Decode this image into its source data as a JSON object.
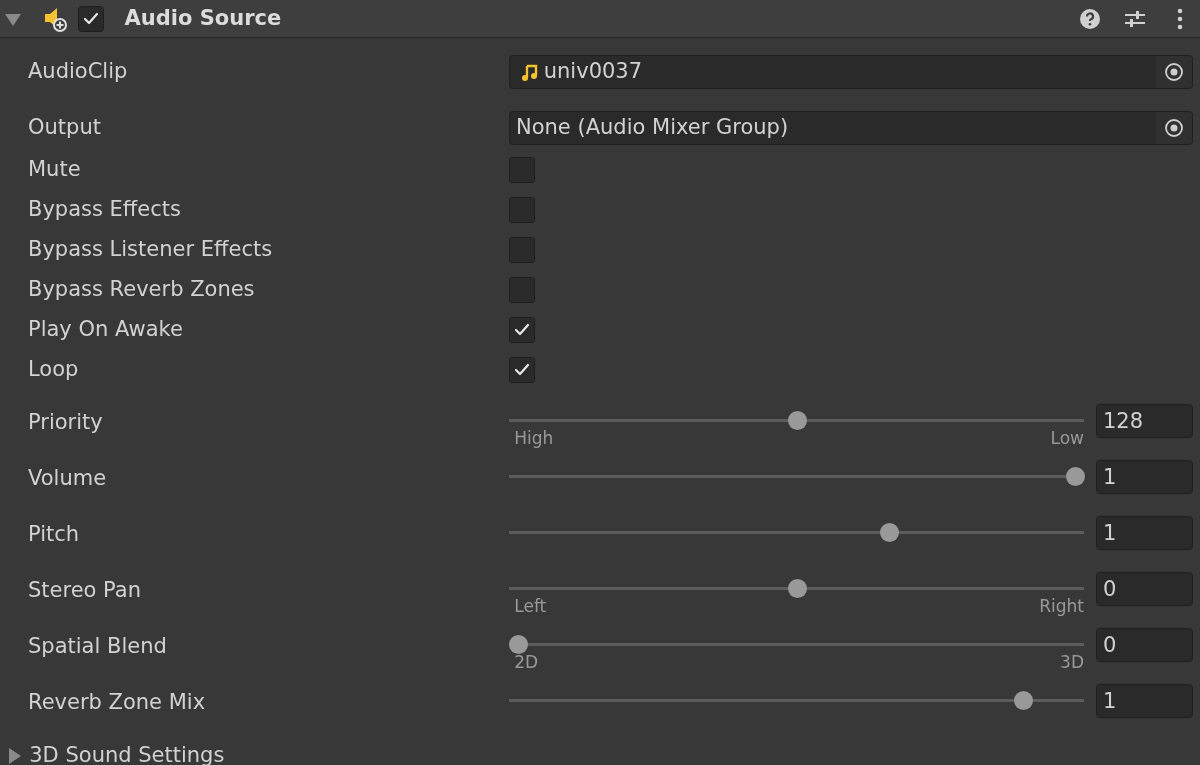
{
  "component": {
    "title": "Audio Source",
    "enabled": true,
    "expanded": true
  },
  "properties": [
    {
      "kind": "clip",
      "label": "AudioClip",
      "value": "univ0037"
    },
    {
      "kind": "object",
      "label": "Output",
      "value": "None (Audio Mixer Group)"
    },
    {
      "kind": "checkbox",
      "label": "Mute",
      "checked": false
    },
    {
      "kind": "checkbox",
      "label": "Bypass Effects",
      "checked": false
    },
    {
      "kind": "checkbox",
      "label": "Bypass Listener Effects",
      "checked": false
    },
    {
      "kind": "checkbox",
      "label": "Bypass Reverb Zones",
      "checked": false
    },
    {
      "kind": "checkbox",
      "label": "Play On Awake",
      "checked": true
    },
    {
      "kind": "checkbox",
      "label": "Loop",
      "checked": true
    },
    {
      "kind": "slider",
      "label": "Priority",
      "level": 0.5,
      "value": "128",
      "min_label": "High",
      "max_label": "Low"
    },
    {
      "kind": "slider",
      "label": "Volume",
      "level": 1,
      "value": "1"
    },
    {
      "kind": "slider",
      "label": "Pitch",
      "level": 0.666,
      "value": "1"
    },
    {
      "kind": "slider",
      "label": "Stereo Pan",
      "level": 0.5,
      "value": "0",
      "min_label": "Left",
      "max_label": "Right"
    },
    {
      "kind": "slider",
      "label": "Spatial Blend",
      "level": 0,
      "value": "0",
      "min_label": "2D",
      "max_label": "3D"
    },
    {
      "kind": "slider",
      "label": "Reverb Zone Mix",
      "level": 0.907,
      "value": "1"
    }
  ],
  "foldout": {
    "label": "3D Sound Settings",
    "expanded": false
  }
}
